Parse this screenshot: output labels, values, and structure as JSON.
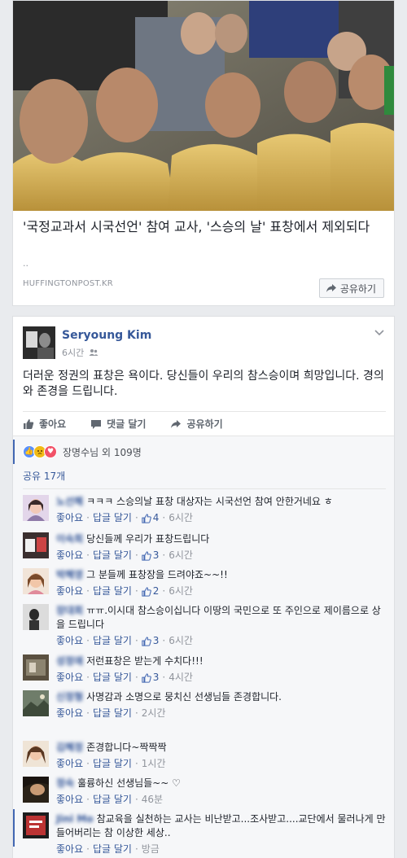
{
  "link": {
    "title": "'국정교과서 시국선언' 참여 교사, '스승의 날' 표창에서 제외되다",
    "desc": "..",
    "source": "HUFFINGTONPOST.KR",
    "share_label": "공유하기"
  },
  "post": {
    "author": "Seryoung Kim",
    "time": "6시간",
    "audience_icon": "friends-icon",
    "text": "더러운 정권의 표창은 욕이다. 당신들이 우리의 참스승이며 희망입니다. 경의와 존경을 드립니다.",
    "actions": {
      "like": "좋아요",
      "comment": "댓글 달기",
      "share": "공유하기"
    },
    "reactions_text": "장명수님 외 109명",
    "shares_text": "공유 17개"
  },
  "comments": [
    {
      "name": "노선해",
      "text": "ㅋㅋㅋ 스승의날 표창 대상자는 시국선언 참여 안한거네요 ㅎ",
      "like": "좋아요",
      "reply": "답글 달기",
      "likes": "4",
      "time": "6시간"
    },
    {
      "name": "이숙희",
      "text": "당신들께 우리가 표창드립니다",
      "like": "좋아요",
      "reply": "답글 달기",
      "likes": "3",
      "time": "6시간"
    },
    {
      "name": "박혜영",
      "text": "그 분들께 표창장을 드려야죠~~!!",
      "like": "좋아요",
      "reply": "답글 달기",
      "likes": "2",
      "time": "6시간"
    },
    {
      "name": "장대회",
      "text": "ㅠㅠ.이시대 참스승이십니다 이땅의 국민으로 또 주인으로 제이름으로 상을 드립니다",
      "like": "좋아요",
      "reply": "답글 달기",
      "likes": "3",
      "time": "6시간"
    },
    {
      "name": "성정애",
      "text": "저런표창은 받는게 수치다!!!",
      "like": "좋아요",
      "reply": "답글 달기",
      "likes": "3",
      "time": "4시간"
    },
    {
      "name": "신정형",
      "text": "사명감과 소명으로 뭉치신 선생님들 존경합니다.",
      "like": "좋아요",
      "reply": "답글 달기",
      "likes": "",
      "time": "2시간"
    },
    {
      "name": "김혜정",
      "text": "존경합니다~짝짝짝",
      "like": "좋아요",
      "reply": "답글 달기",
      "likes": "",
      "time": "1시간"
    },
    {
      "name": "정숙",
      "text": "훌륭하신 선생님들~~ ♡",
      "like": "좋아요",
      "reply": "답글 달기",
      "likes": "",
      "time": "46분"
    },
    {
      "name": "Jini Mo",
      "text": "참교육을 실천하는 교사는 비난받고...조사받고....교단에서 물러나게 만들어버리는 참 이상한 세상..",
      "like": "좋아요",
      "reply": "답글 달기",
      "likes": "",
      "time": "방금"
    }
  ]
}
